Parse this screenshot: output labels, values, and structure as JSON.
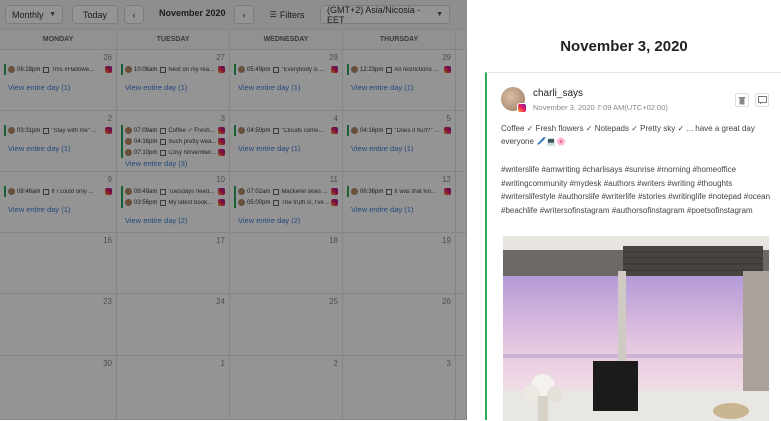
{
  "toolbar": {
    "view_label": "Monthly",
    "today_label": "Today",
    "prev_label": "‹",
    "next_label": "›",
    "period_label": "November 2020",
    "filters_label": "Filters",
    "timezone_label": "(GMT+2) Asia/Nicosia - EET"
  },
  "calendar": {
    "weekdays": [
      "MONDAY",
      "TUESDAY",
      "WEDNESDAY",
      "THURSDAY"
    ],
    "view_day_label": "View entire day",
    "weeks": [
      {
        "days": [
          {
            "num": "26",
            "count": "(1)",
            "events": [
              {
                "time": "06:28pm",
                "text": "This #Hallowe..."
              }
            ]
          },
          {
            "num": "27",
            "count": "(1)",
            "events": [
              {
                "time": "10:06am",
                "text": "Next on my rea..."
              }
            ]
          },
          {
            "num": "28",
            "count": "(1)",
            "events": [
              {
                "time": "05:49pm",
                "text": "\"Everybody is ..."
              }
            ]
          },
          {
            "num": "29",
            "count": "(1)",
            "events": [
              {
                "time": "12:23pm",
                "text": "All restrictions ..."
              }
            ]
          }
        ]
      },
      {
        "days": [
          {
            "num": "2",
            "count": "(1)",
            "events": [
              {
                "time": "03:31pm",
                "text": "\"Stay with me\" ..."
              }
            ]
          },
          {
            "num": "3",
            "count": "(3)",
            "events": [
              {
                "time": "07:09am",
                "text": "Coffee ✓ Fresh..."
              },
              {
                "time": "04:16pm",
                "text": "Such pretty wea..."
              },
              {
                "time": "07:10pm",
                "text": "Cosy November..."
              }
            ]
          },
          {
            "num": "4",
            "count": "(1)",
            "events": [
              {
                "time": "04:50pm",
                "text": "\"Clouds come..."
              }
            ]
          },
          {
            "num": "5",
            "count": "(1)",
            "events": [
              {
                "time": "04:16pm",
                "text": "\"Does it hurt?\" ..."
              }
            ]
          }
        ]
      },
      {
        "days": [
          {
            "num": "9",
            "count": "(1)",
            "events": [
              {
                "time": "08:46am",
                "text": "If I could only ..."
              }
            ]
          },
          {
            "num": "10",
            "count": "(2)",
            "events": [
              {
                "time": "09:49am",
                "text": "Tuesdays need..."
              },
              {
                "time": "03:56pm",
                "text": "My latest book..."
              }
            ]
          },
          {
            "num": "11",
            "count": "(2)",
            "events": [
              {
                "time": "07:02am",
                "text": "Mackerel skies ..."
              },
              {
                "time": "05:00pm",
                "text": "The truth is, I've ..."
              }
            ]
          },
          {
            "num": "12",
            "count": "(1)",
            "events": [
              {
                "time": "06:36pm",
                "text": "It was that kin..."
              }
            ]
          }
        ]
      },
      {
        "days": [
          {
            "num": "16"
          },
          {
            "num": "17"
          },
          {
            "num": "18"
          },
          {
            "num": "19"
          }
        ]
      },
      {
        "days": [
          {
            "num": "23"
          },
          {
            "num": "24"
          },
          {
            "num": "25"
          },
          {
            "num": "26"
          }
        ]
      },
      {
        "days": [
          {
            "num": "30"
          },
          {
            "num": "1"
          },
          {
            "num": "2"
          },
          {
            "num": "3"
          }
        ]
      }
    ]
  },
  "panel": {
    "date_title": "November 3, 2020",
    "username": "charli_says",
    "posted_at": "November 3, 2020 7:09 AM(UTC+02:00)",
    "caption": "Coffee ✓ Fresh flowers ✓ Notepads ✓ Pretty sky ✓ ... have a great day everyone 🖊️💻🌸",
    "hashtags": "#writerslife #amwriting #charlisays #sunrise #morning #homeoffice #writingcommunity #mydesk #authors #writers #writing #thoughts #writerslifestyle #authorslife #writerlife #stories #writinglife #notepad #ocean #beachlife #writersofinstagram #authorsofinstagram #poetsofinstagram"
  },
  "colors": {
    "accent_green": "#2eaa5c",
    "link_blue": "#3b7dd8"
  }
}
